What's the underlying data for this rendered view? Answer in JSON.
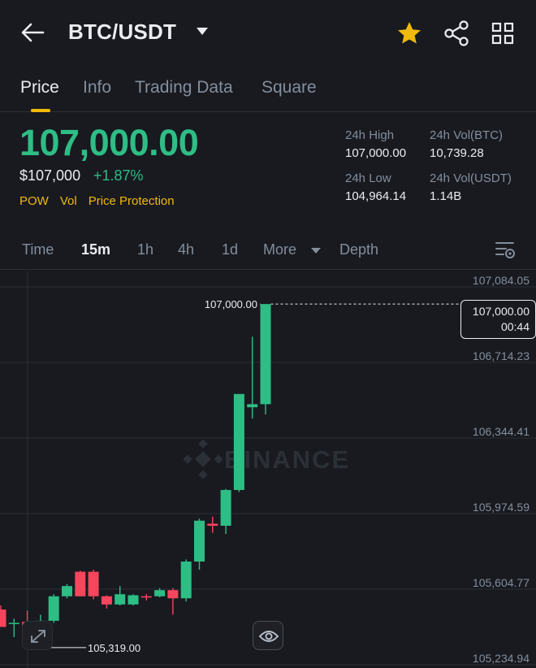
{
  "header": {
    "pair": "BTC/USDT",
    "icons": [
      "back-arrow-icon",
      "caret-down-icon",
      "star-icon",
      "share-icon",
      "grid-icon"
    ],
    "star_color": "#f0b90b"
  },
  "tabs": [
    {
      "label": "Price",
      "active": true
    },
    {
      "label": "Info"
    },
    {
      "label": "Trading Data"
    },
    {
      "label": "Square"
    }
  ],
  "ticker": {
    "last_price": "107,000.00",
    "fiat_price": "$107,000",
    "change_percent": "+1.87%",
    "tags": [
      "POW",
      "Vol",
      "Price Protection"
    ],
    "high_label": "24h High",
    "high_value": "107,000.00",
    "vol_btc_label": "24h Vol(BTC)",
    "vol_btc_value": "10,739.28",
    "low_label": "24h Low",
    "low_value": "104,964.14",
    "vol_usdt_label": "24h Vol(USDT)",
    "vol_usdt_value": "1.14B"
  },
  "intervals": {
    "items": [
      "Time",
      "15m",
      "1h",
      "4h",
      "1d",
      "More",
      "Depth"
    ],
    "active": "15m"
  },
  "colors": {
    "up": "#2ebd85",
    "down": "#f6465d",
    "accent": "#f0b90b",
    "background": "#181a20",
    "grid": "#2b2f36"
  },
  "chart_data": {
    "type": "candlestick",
    "watermark": "BINANCE",
    "y_ticks": [
      "107,084.05",
      "106,714.23",
      "106,344.41",
      "105,974.59",
      "105,604.77",
      "105,234.94"
    ],
    "ylim": [
      105234.94,
      107084.05
    ],
    "last_price_label": "107,000.00",
    "countdown": "00:44",
    "high_marker": "107,000.00",
    "low_marker": "105,319.00",
    "candles": [
      {
        "o": 105505,
        "h": 105525,
        "l": 105435,
        "c": 105420
      },
      {
        "o": 105440,
        "h": 105460,
        "l": 105370,
        "c": 105440
      },
      {
        "o": 105445,
        "h": 105500,
        "l": 105319,
        "c": 105410
      },
      {
        "o": 105440,
        "h": 105480,
        "l": 105415,
        "c": 105450
      },
      {
        "o": 105450,
        "h": 105580,
        "l": 105440,
        "c": 105570
      },
      {
        "o": 105570,
        "h": 105630,
        "l": 105560,
        "c": 105620
      },
      {
        "o": 105690,
        "h": 105695,
        "l": 105570,
        "c": 105570
      },
      {
        "o": 105690,
        "h": 105700,
        "l": 105555,
        "c": 105570
      },
      {
        "o": 105570,
        "h": 105575,
        "l": 105510,
        "c": 105530
      },
      {
        "o": 105530,
        "h": 105620,
        "l": 105525,
        "c": 105580
      },
      {
        "o": 105530,
        "h": 105580,
        "l": 105525,
        "c": 105575
      },
      {
        "o": 105570,
        "h": 105580,
        "l": 105550,
        "c": 105565
      },
      {
        "o": 105570,
        "h": 105610,
        "l": 105565,
        "c": 105600
      },
      {
        "o": 105600,
        "h": 105610,
        "l": 105480,
        "c": 105560
      },
      {
        "o": 105560,
        "h": 105750,
        "l": 105545,
        "c": 105740
      },
      {
        "o": 105740,
        "h": 105950,
        "l": 105700,
        "c": 105940
      },
      {
        "o": 105925,
        "h": 105960,
        "l": 105880,
        "c": 105915
      },
      {
        "o": 105915,
        "h": 106095,
        "l": 105875,
        "c": 106090
      },
      {
        "o": 106090,
        "h": 106540,
        "l": 106080,
        "c": 106560
      },
      {
        "o": 106495,
        "h": 106840,
        "l": 106440,
        "c": 106510
      },
      {
        "o": 106510,
        "h": 107000,
        "l": 106460,
        "c": 107000
      }
    ]
  }
}
